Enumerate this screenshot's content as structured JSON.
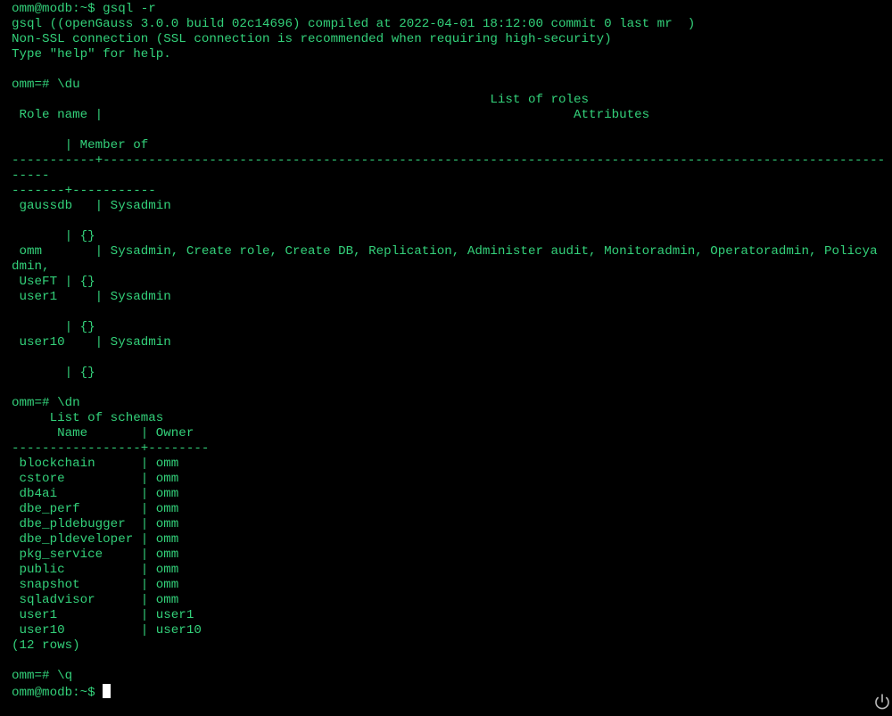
{
  "terminal": {
    "lines": [
      "omm@modb:~$ gsql -r",
      "gsql ((openGauss 3.0.0 build 02c14696) compiled at 2022-04-01 18:12:00 commit 0 last mr  )",
      "Non-SSL connection (SSL connection is recommended when requiring high-security)",
      "Type \"help\" for help.",
      "",
      "omm=# \\du",
      "                                                               List of roles",
      " Role name |                                                              Attributes",
      "",
      "       | Member of",
      "-----------+-----------------------------------------------------------------------------------------------------------------",
      "-----",
      "-------+-----------",
      " gaussdb   | Sysadmin",
      "",
      "       | {}",
      " omm       | Sysadmin, Create role, Create DB, Replication, Administer audit, Monitoradmin, Operatoradmin, Policya",
      "dmin,",
      " UseFT | {}",
      " user1     | Sysadmin",
      "",
      "       | {}",
      " user10    | Sysadmin",
      "",
      "       | {}",
      "",
      "omm=# \\dn",
      "     List of schemas",
      "      Name       | Owner",
      "-----------------+--------",
      " blockchain      | omm",
      " cstore          | omm",
      " db4ai           | omm",
      " dbe_perf        | omm",
      " dbe_pldebugger  | omm",
      " dbe_pldeveloper | omm",
      " pkg_service     | omm",
      " public          | omm",
      " snapshot        | omm",
      " sqladvisor      | omm",
      " user1           | user1",
      " user10          | user10",
      "(12 rows)",
      "",
      "omm=# \\q"
    ],
    "prompt": "omm@modb:~$ ",
    "colors": {
      "background": "#000000",
      "text": "#33d17a",
      "cursor": "#ffffff",
      "icon": "#bbbbbb"
    }
  },
  "power_button": {
    "icon": "power-icon"
  }
}
